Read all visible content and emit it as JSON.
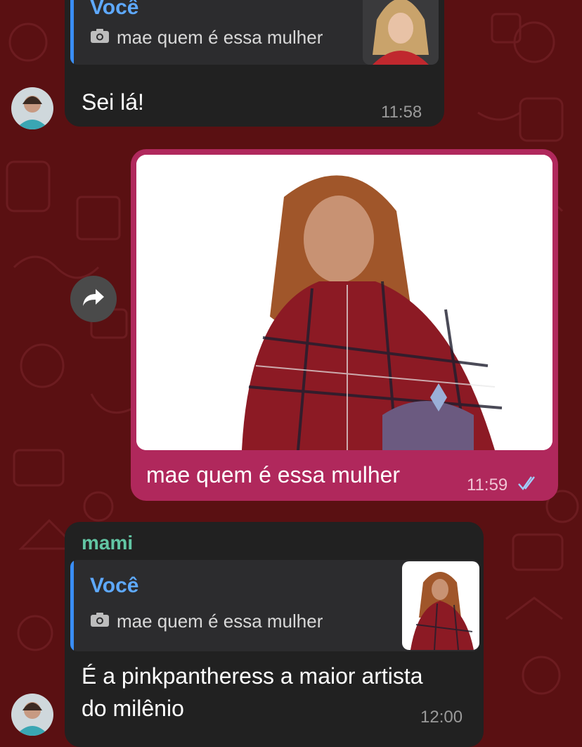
{
  "messages": [
    {
      "reply": {
        "sender": "Você",
        "text": "mae quem é essa mulher"
      },
      "text": "Sei lá!",
      "time": "11:58"
    },
    {
      "text": "mae quem é essa mulher",
      "time": "11:59",
      "status": "read"
    },
    {
      "sender": "mami",
      "reply": {
        "sender": "Você",
        "text": "mae quem é essa mulher"
      },
      "text_line1": "É a pinkpantheress a maior artista",
      "text_line2": "do milênio",
      "time": "12:00"
    }
  ],
  "icons": {
    "forward": "forward-arrow-icon",
    "camera": "camera-icon",
    "read": "double-check-icon"
  },
  "colors": {
    "background": "#5a1012",
    "incoming_bubble": "#212121",
    "outgoing_bubble": "#b0285c",
    "reply_accent": "#3a8ef6",
    "sender_name": "#62c6a4"
  }
}
